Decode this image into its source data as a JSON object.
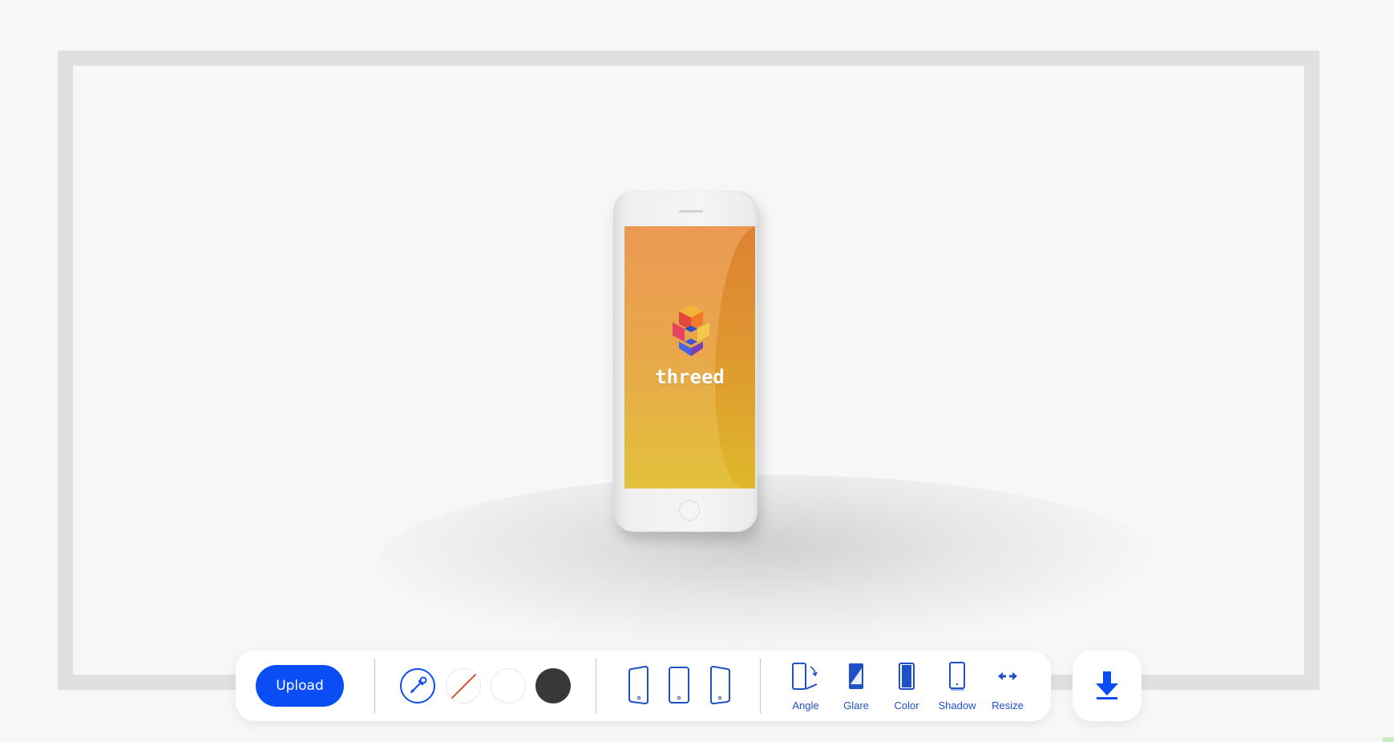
{
  "canvas": {
    "mockup": {
      "screen_brand": "threed",
      "colors": {
        "frame": "#e0e0e0",
        "screen_top": "#eb9a55",
        "screen_bottom": "#e2c13c"
      }
    }
  },
  "toolbar": {
    "upload_label": "Upload",
    "accent_color": "#0a4df5",
    "swatches": [
      {
        "name": "eyedropper-icon"
      },
      {
        "name": "no-color",
        "color": "#ffffff"
      },
      {
        "name": "white",
        "color": "#ffffff"
      },
      {
        "name": "dark",
        "color": "#383838"
      }
    ],
    "devices": [
      {
        "name": "phone-left-icon"
      },
      {
        "name": "phone-front-icon"
      },
      {
        "name": "phone-right-icon"
      }
    ],
    "tools": [
      {
        "label": "Angle",
        "icon": "angle-icon"
      },
      {
        "label": "Glare",
        "icon": "glare-icon"
      },
      {
        "label": "Color",
        "icon": "color-icon"
      },
      {
        "label": "Shadow",
        "icon": "shadow-icon"
      },
      {
        "label": "Resize",
        "icon": "resize-icon"
      }
    ],
    "download_icon": "download-icon"
  }
}
